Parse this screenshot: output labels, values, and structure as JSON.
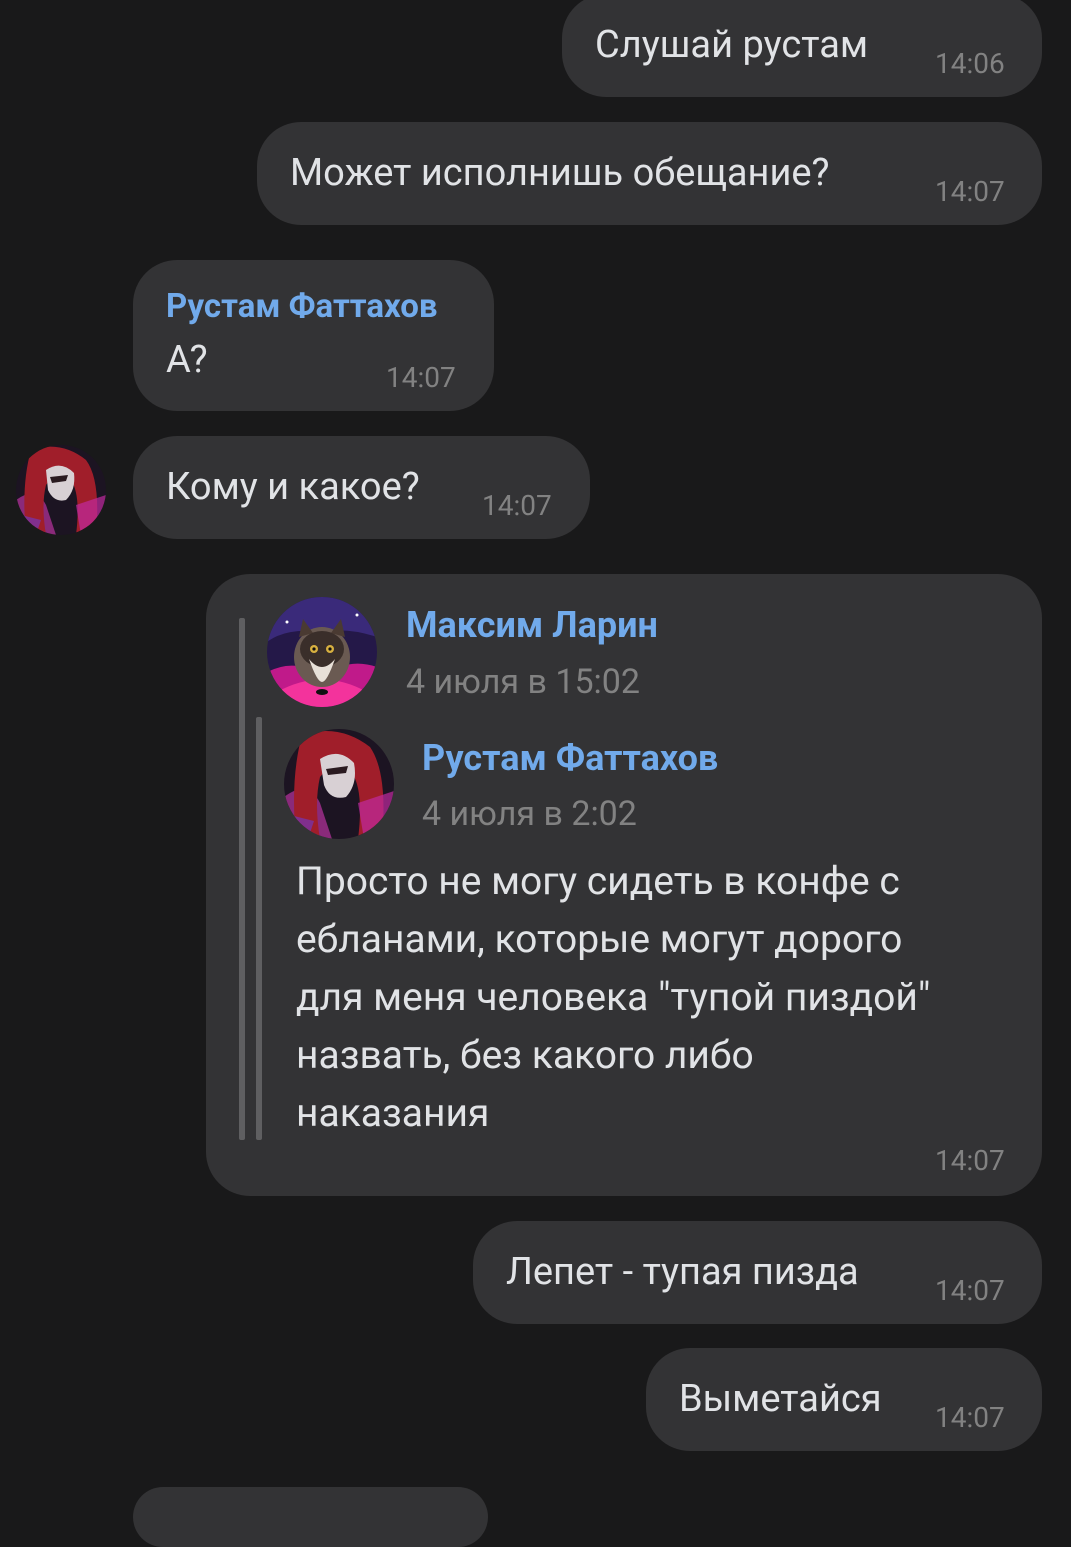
{
  "messages": [
    {
      "id": "m1",
      "text": "Слушай рустам",
      "time": "14:06",
      "outgoing": true
    },
    {
      "id": "m2",
      "text": "Может исполнишь обещание?",
      "time": "14:07",
      "outgoing": true
    },
    {
      "id": "m3",
      "author": "Рустам Фаттахов",
      "text": "А?",
      "time": "14:07",
      "outgoing": false
    },
    {
      "id": "m4",
      "text": "Кому и какое?",
      "time": "14:07",
      "outgoing": false,
      "avatar": "anime-red-hair-avatar"
    },
    {
      "id": "m5",
      "time": "14:07",
      "outgoing": true,
      "forwarded": {
        "author": "Максим Ларин",
        "date": "4 июля в 15:02",
        "avatar": "cat-avatar",
        "nested": {
          "author": "Рустам Фаттахов",
          "date": "4 июля в 2:02",
          "avatar": "anime-red-hair-avatar",
          "text": "Просто не могу сидеть в конфе с\nебланами, которые могут дорого\nдля меня человека \"тупой пиздой\"\nназвать, без какого либо\nнаказания"
        }
      }
    },
    {
      "id": "m6",
      "text": "Лепет - тупая пизда",
      "time": "14:07",
      "outgoing": true
    },
    {
      "id": "m7",
      "text": "Выметайся",
      "time": "14:07",
      "outgoing": true
    }
  ],
  "colors": {
    "background": "#19191a",
    "bubble": "#333335",
    "link": "#71aaeb",
    "time": "#828282",
    "text": "#e1e3e6"
  }
}
